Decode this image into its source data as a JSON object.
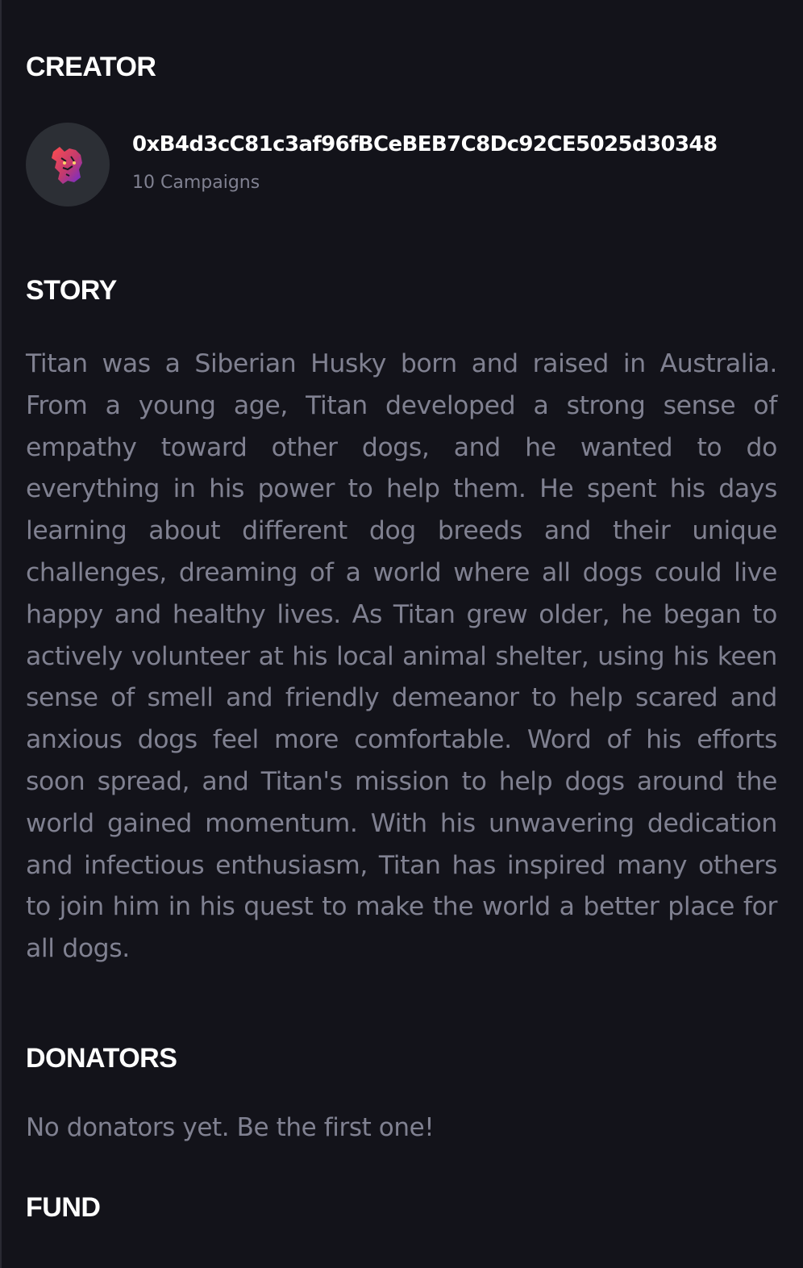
{
  "creator": {
    "heading": "CREATOR",
    "avatar_icon": "tiger-logo-icon",
    "address": "0xB4d3cC81c3af96fBCeBEB7C8Dc92CE5025d30348",
    "campaigns": "10 Campaigns"
  },
  "story": {
    "heading": "STORY",
    "text": "Titan was a Siberian Husky born and raised in Australia. From a young age, Titan developed a strong sense of empathy toward other dogs, and he wanted to do everything in his power to help them. He spent his days learning about different dog breeds and their unique challenges, dreaming of a world where all dogs could live happy and healthy lives. As Titan grew older, he began to actively volunteer at his local animal shelter, using his keen sense of smell and friendly demeanor to help scared and anxious dogs feel more comfortable. Word of his efforts soon spread, and Titan's mission to help dogs around the world gained momentum. With his unwavering dedication and infectious enthusiasm, Titan has inspired many others to join him in his quest to make the world a better place for all dogs."
  },
  "donators": {
    "heading": "DONATORS",
    "empty_message": "No donators yet. Be the first one!"
  },
  "fund": {
    "heading": "FUND"
  },
  "colors": {
    "background": "#13131a",
    "heading": "#ffffff",
    "body_text": "#808191",
    "avatar_bg": "#2c2f35"
  }
}
